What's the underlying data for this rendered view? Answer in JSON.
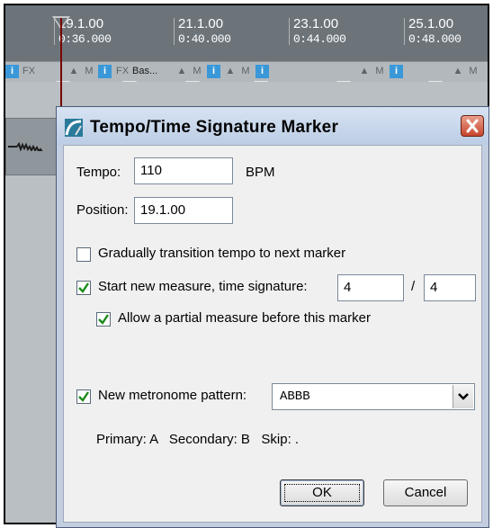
{
  "ruler": {
    "ticks": [
      {
        "bar": "19.1.00",
        "time": "0:36.000"
      },
      {
        "bar": "21.1.00",
        "time": "0:40.000"
      },
      {
        "bar": "23.1.00",
        "time": "0:44.000"
      },
      {
        "bar": "25.1.00",
        "time": "0:48.000"
      }
    ]
  },
  "track_buttons": {
    "fx": "FX",
    "m": "M",
    "i": "i",
    "bas": "Bas..."
  },
  "dialog": {
    "title": "Tempo/Time Signature Marker",
    "tempo_label": "Tempo:",
    "tempo_value": "110",
    "bpm_label": "BPM",
    "position_label": "Position:",
    "position_value": "19.1.00",
    "gradual_label": "Gradually transition tempo to next marker",
    "gradual_checked": false,
    "new_measure_label": "Start new measure, time signature:",
    "new_measure_checked": true,
    "numerator": "4",
    "slash": "/",
    "denominator": "4",
    "partial_label": "Allow a partial measure before this marker",
    "partial_checked": true,
    "metronome_label": "New metronome pattern:",
    "metronome_checked": true,
    "metronome_value": "ABBB",
    "legend": "Primary: A   Secondary: B   Skip: .",
    "ok_label": "OK",
    "cancel_label": "Cancel"
  },
  "colors": {
    "ruler_bg": "#6c747a",
    "playhead": "#7a0000",
    "dialog_title_bg": "#c3cfe0",
    "close_button": "#c8452c",
    "check_mark": "#1a8a1a",
    "info_button": "#3a98d8"
  }
}
